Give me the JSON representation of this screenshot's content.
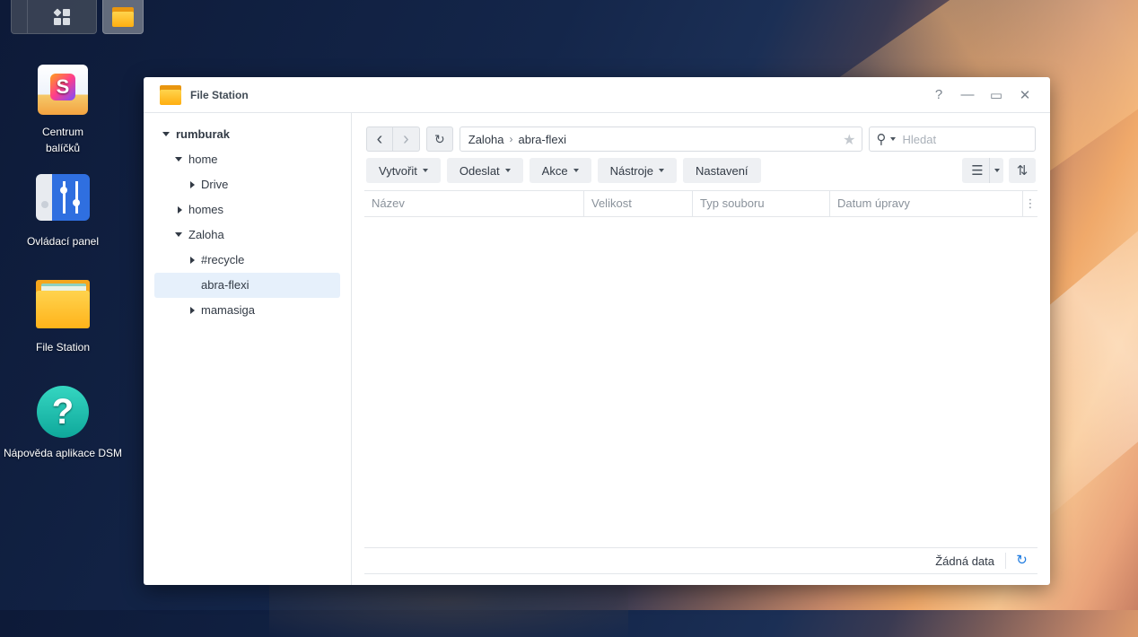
{
  "desktop": {
    "icons": [
      {
        "label": "Centrum\nbalíčků"
      },
      {
        "label": "Ovládací panel"
      },
      {
        "label": "File Station"
      },
      {
        "label": "Nápověda aplikace DSM"
      }
    ],
    "package_glyph": "S",
    "help_glyph": "?"
  },
  "window": {
    "title": "File Station",
    "buttons": {
      "help": "?",
      "minimize": "—",
      "maximize": "▭",
      "close": "✕"
    }
  },
  "tree": [
    {
      "label": "rumburak",
      "bold": true
    },
    {
      "label": "home"
    },
    {
      "label": "Drive"
    },
    {
      "label": "homes"
    },
    {
      "label": "Zaloha"
    },
    {
      "label": "#recycle"
    },
    {
      "label": "abra-flexi",
      "selected": true
    },
    {
      "label": "mamasiga"
    }
  ],
  "path": {
    "segments": [
      "Zaloha",
      "abra-flexi"
    ],
    "separator": "›"
  },
  "search": {
    "placeholder": "Hledat"
  },
  "toolbar": {
    "create": "Vytvořit",
    "upload": "Odeslat",
    "action": "Akce",
    "tools": "Nástroje",
    "settings": "Nastavení"
  },
  "table": {
    "columns": [
      "Název",
      "Velikost",
      "Typ souboru",
      "Datum úpravy"
    ]
  },
  "footer": {
    "status": "Žádná data"
  },
  "icons": {
    "back": "‹",
    "forward": "›",
    "refresh": "↻",
    "star": "★",
    "search": "⚲",
    "list": "☰",
    "sort": "⇅",
    "more": "⋮"
  },
  "colors": {
    "accent": "#1e7be0",
    "selected_bg": "#e6f0fb"
  }
}
